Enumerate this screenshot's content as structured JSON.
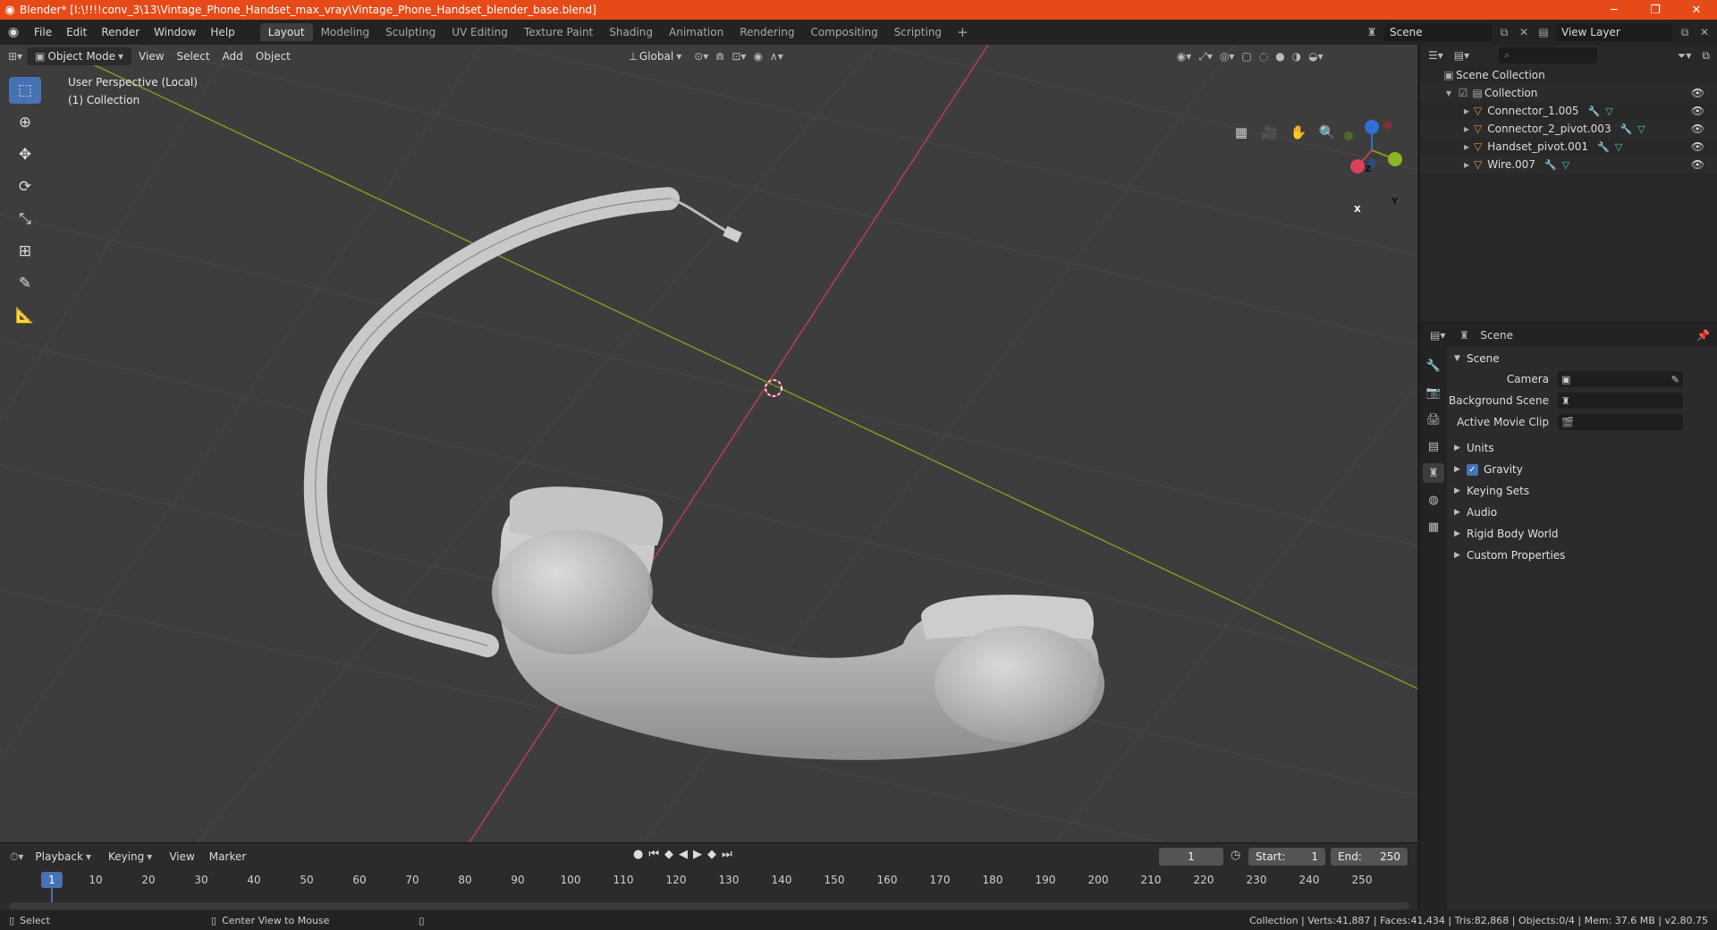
{
  "window": {
    "title": "Blender* [I:\\!!!!conv_3\\13\\Vintage_Phone_Handset_max_vray\\Vintage_Phone_Handset_blender_base.blend]",
    "minimize": "─",
    "maximize": "❐",
    "close": "✕"
  },
  "menu": [
    "File",
    "Edit",
    "Render",
    "Window",
    "Help"
  ],
  "workspaces": [
    "Layout",
    "Modeling",
    "Sculpting",
    "UV Editing",
    "Texture Paint",
    "Shading",
    "Animation",
    "Rendering",
    "Compositing",
    "Scripting"
  ],
  "workspace_add": "+",
  "scene_name": "Scene",
  "view_layer": "View Layer",
  "viewport": {
    "mode": "Object Mode",
    "menus": [
      "View",
      "Select",
      "Add",
      "Object"
    ],
    "transform_orientation": "Global",
    "perspective_label": "User Perspective (Local)",
    "collection_label": "(1) Collection",
    "gizmo": {
      "x": "X",
      "y": "Y",
      "z": "Z"
    }
  },
  "outliner": {
    "root": "Scene Collection",
    "collection": "Collection",
    "objects": [
      "Connector_1.005",
      "Connector_2_pivot.003",
      "Handset_pivot.001",
      "Wire.007"
    ]
  },
  "properties": {
    "header": "Scene",
    "panel": "Scene",
    "rows": [
      {
        "label": "Camera"
      },
      {
        "label": "Background Scene"
      },
      {
        "label": "Active Movie Clip"
      }
    ],
    "subpanels": [
      "Units",
      "Gravity",
      "Keying Sets",
      "Audio",
      "Rigid Body World",
      "Custom Properties"
    ]
  },
  "timeline": {
    "menus": [
      "Playback",
      "Keying",
      "View",
      "Marker"
    ],
    "current_frame": "1",
    "start_label": "Start:",
    "start": "1",
    "end_label": "End:",
    "end": "250",
    "ticks": [
      "10",
      "20",
      "30",
      "40",
      "50",
      "60",
      "70",
      "80",
      "90",
      "100",
      "110",
      "120",
      "130",
      "140",
      "150",
      "160",
      "170",
      "180",
      "190",
      "200",
      "210",
      "220",
      "230",
      "240",
      "250"
    ]
  },
  "status": {
    "select": "Select",
    "center_view": "Center View to Mouse",
    "stats": "Collection | Verts:41,887 | Faces:41,434 | Tris:82,868 | Objects:0/4 | Mem: 37.6 MB | v2.80.75"
  },
  "colors": {
    "titlebar": "#e64a19",
    "accent": "#4772b3",
    "x_axis": "#c23e4f",
    "y_axis": "#7ea21c",
    "object_icon": "#e88c39"
  }
}
